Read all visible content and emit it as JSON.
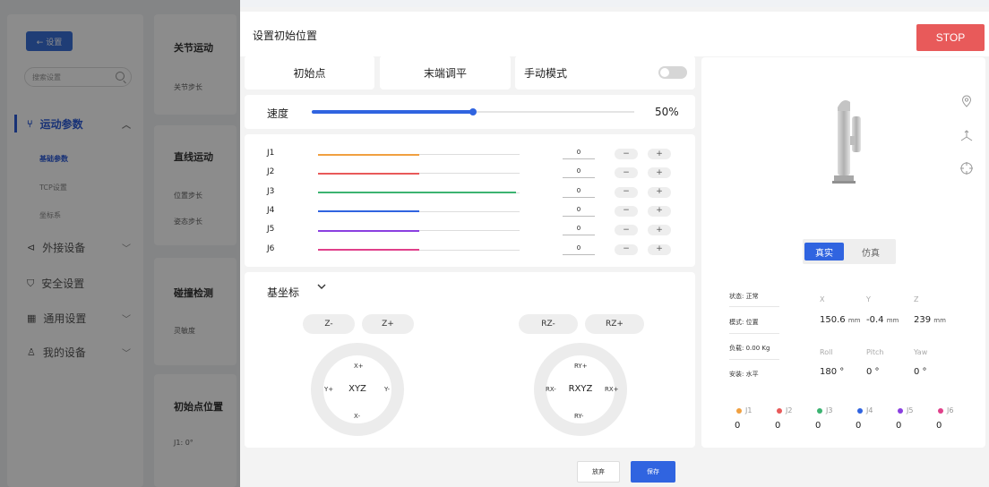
{
  "background": {
    "back_button": "← 设置",
    "search_placeholder": "搜索设置",
    "nav": [
      {
        "label": "运动参数",
        "icon": "branch-icon",
        "active": true
      },
      {
        "label": "外接设备",
        "icon": "plug-icon",
        "active": false
      },
      {
        "label": "安全设置",
        "icon": "shield-icon",
        "active": false
      },
      {
        "label": "通用设置",
        "icon": "grid-icon",
        "active": false
      },
      {
        "label": "我的设备",
        "icon": "user-icon",
        "active": false
      }
    ],
    "subnav": [
      {
        "label": "基础参数",
        "active": true
      },
      {
        "label": "TCP设置",
        "active": false
      },
      {
        "label": "坐标系",
        "active": false
      }
    ],
    "cards": [
      {
        "title": "关节运动",
        "items": [
          "关节步长"
        ]
      },
      {
        "title": "直线运动",
        "items": [
          "位置步长",
          "姿态步长"
        ]
      },
      {
        "title": "碰撞检测",
        "items": [
          "灵敏度"
        ]
      },
      {
        "title": "初始点位置",
        "items": [
          "J1: 0°"
        ]
      }
    ]
  },
  "dialog": {
    "title": "设置初始位置",
    "stop_label": "STOP",
    "tabs": [
      "初始点",
      "末端调平",
      "手动模式"
    ],
    "manual_mode_on": false,
    "speed": {
      "label": "速度",
      "value": 0.5,
      "value_text": "50%"
    },
    "joints": [
      {
        "name": "J1",
        "value": "0",
        "color": "#f0a040",
        "level": 0.5
      },
      {
        "name": "J2",
        "value": "0",
        "color": "#e85a5a",
        "level": 0.5
      },
      {
        "name": "J3",
        "value": "0",
        "color": "#3cb371",
        "level": 0.98
      },
      {
        "name": "J4",
        "value": "0",
        "color": "#3064e0",
        "level": 0.5
      },
      {
        "name": "J5",
        "value": "0",
        "color": "#8a3fe0",
        "level": 0.5
      },
      {
        "name": "J6",
        "value": "0",
        "color": "#e0408a",
        "level": 0.5
      }
    ],
    "joint_minus": "−",
    "joint_plus": "+",
    "coord_system": "基坐标",
    "xyz_pad": {
      "z_minus": "Z-",
      "z_plus": "Z+",
      "top": "X+",
      "bottom": "X-",
      "left": "Y+",
      "right": "Y-",
      "center": "XYZ"
    },
    "rxyz_pad": {
      "rz_minus": "RZ-",
      "rz_plus": "RZ+",
      "top": "RY+",
      "bottom": "RY-",
      "left": "RX-",
      "right": "RX+",
      "center": "RXYZ"
    },
    "view_modes": {
      "real": "真实",
      "sim": "仿真"
    },
    "status": [
      {
        "label": "状态: 正常"
      },
      {
        "label": "模式: 位置"
      },
      {
        "label": "负载: 0.00 Kg"
      },
      {
        "label": "安装: 水平"
      }
    ],
    "position": {
      "x_label": "X",
      "y_label": "Y",
      "z_label": "Z",
      "x_value": "150.6",
      "y_value": "-0.4",
      "z_value": "239",
      "unit": "mm"
    },
    "orientation": {
      "roll_label": "Roll",
      "pitch_label": "Pitch",
      "yaw_label": "Yaw",
      "roll_value": "180 °",
      "pitch_value": "0 °",
      "yaw_value": "0 °"
    },
    "joint_readout": [
      {
        "name": "J1",
        "value": "0",
        "color": "#f0a040"
      },
      {
        "name": "J2",
        "value": "0",
        "color": "#e85a5a"
      },
      {
        "name": "J3",
        "value": "0",
        "color": "#3cb371"
      },
      {
        "name": "J4",
        "value": "0",
        "color": "#3064e0"
      },
      {
        "name": "J5",
        "value": "0",
        "color": "#8a3fe0"
      },
      {
        "name": "J6",
        "value": "0",
        "color": "#e0408a"
      }
    ],
    "cancel_label": "放弃",
    "save_label": "保存",
    "side_icons": [
      "location-pin-icon",
      "axes-icon",
      "crosshair-icon"
    ]
  }
}
